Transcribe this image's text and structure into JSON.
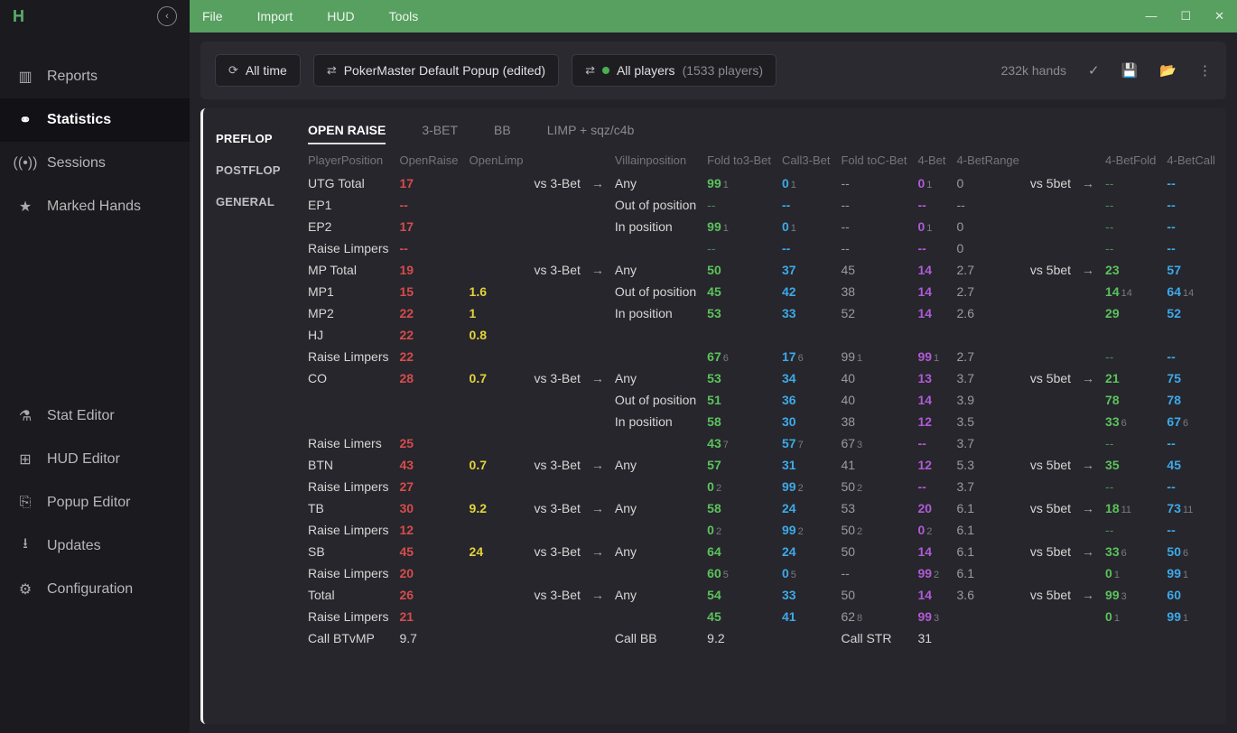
{
  "menubar": {
    "items": [
      "File",
      "Import",
      "HUD",
      "Tools"
    ]
  },
  "sidebar": {
    "top": [
      {
        "label": "Reports"
      },
      {
        "label": "Statistics"
      },
      {
        "label": "Sessions"
      },
      {
        "label": "Marked Hands"
      }
    ],
    "bottom": [
      {
        "label": "Stat Editor"
      },
      {
        "label": "HUD Editor"
      },
      {
        "label": "Popup Editor"
      },
      {
        "label": "Updates"
      },
      {
        "label": "Configuration"
      }
    ]
  },
  "toolbar": {
    "time_label": "All time",
    "popup_label": "PokerMaster Default Popup (edited)",
    "players_label": "All players",
    "players_count": "(1533 players)",
    "hands": "232k hands"
  },
  "subnav": {
    "items": [
      "PREFLOP",
      "POSTFLOP",
      "GENERAL"
    ],
    "active": 0
  },
  "stat_tabs": {
    "items": [
      "OPEN RAISE",
      "3-BET",
      "BB",
      "LIMP + sqz/c4b"
    ],
    "active": 0
  },
  "headers": {
    "left": [
      "PlayerPosition",
      "OpenRaise",
      "OpenLimp"
    ],
    "right": [
      "Villainposition",
      "Fold to3-Bet",
      "Call3-Bet",
      "Fold toC-Bet",
      "4-Bet",
      "4-BetRange",
      "4-BetFold",
      "4-BetCall"
    ]
  },
  "labels": {
    "vs3bet": "vs 3-Bet",
    "vs5bet": "vs 5bet",
    "arrow": "→"
  },
  "groups": [
    {
      "rows": [
        {
          "pp": "UTG Total",
          "or": {
            "v": "17",
            "c": "red"
          },
          "ol": null,
          "vs3": true,
          "vil": "Any",
          "f3": {
            "v": "99",
            "s": "1",
            "c": "green"
          },
          "c3": {
            "v": "0",
            "s": "1",
            "c": "blue"
          },
          "fc": {
            "v": "--",
            "c": "grey"
          },
          "b4": {
            "v": "0",
            "s": "1",
            "c": "purple"
          },
          "rng": {
            "v": "0",
            "c": "grey"
          },
          "vs5": true,
          "bf": {
            "v": "--",
            "c": "dash"
          },
          "bc": {
            "v": "--",
            "c": "blue"
          }
        },
        {
          "pp": "EP1",
          "or": {
            "v": "--",
            "c": "red"
          },
          "vil": "Out of position",
          "f3": {
            "v": "--",
            "c": "dash"
          },
          "c3": {
            "v": "--",
            "c": "blue"
          },
          "fc": {
            "v": "--",
            "c": "grey"
          },
          "b4": {
            "v": "--",
            "c": "purple"
          },
          "rng": {
            "v": "--",
            "c": "grey"
          },
          "bf": {
            "v": "--",
            "c": "dash"
          },
          "bc": {
            "v": "--",
            "c": "blue"
          }
        },
        {
          "pp": "EP2",
          "or": {
            "v": "17",
            "c": "red"
          },
          "vil": "In position",
          "f3": {
            "v": "99",
            "s": "1",
            "c": "green"
          },
          "c3": {
            "v": "0",
            "s": "1",
            "c": "blue"
          },
          "fc": {
            "v": "--",
            "c": "grey"
          },
          "b4": {
            "v": "0",
            "s": "1",
            "c": "purple"
          },
          "rng": {
            "v": "0",
            "c": "grey"
          },
          "bf": {
            "v": "--",
            "c": "dash"
          },
          "bc": {
            "v": "--",
            "c": "blue"
          }
        },
        {
          "pp": "Raise Limpers",
          "or": {
            "v": "--",
            "c": "red"
          },
          "f3": {
            "v": "--",
            "c": "dash"
          },
          "c3": {
            "v": "--",
            "c": "blue"
          },
          "fc": {
            "v": "--",
            "c": "grey"
          },
          "b4": {
            "v": "--",
            "c": "purple"
          },
          "rng": {
            "v": "0",
            "c": "grey"
          },
          "bf": {
            "v": "--",
            "c": "dash"
          },
          "bc": {
            "v": "--",
            "c": "blue"
          }
        }
      ]
    },
    {
      "rows": [
        {
          "pp": "MP Total",
          "or": {
            "v": "19",
            "c": "red"
          },
          "vs3": true,
          "vil": "Any",
          "f3": {
            "v": "50",
            "c": "green"
          },
          "c3": {
            "v": "37",
            "c": "blue"
          },
          "fc": {
            "v": "45",
            "c": "grey"
          },
          "b4": {
            "v": "14",
            "c": "purple"
          },
          "rng": {
            "v": "2.7",
            "c": "grey"
          },
          "vs5": true,
          "bf": {
            "v": "23",
            "c": "green"
          },
          "bc": {
            "v": "57",
            "c": "blue"
          }
        },
        {
          "pp": "MP1",
          "or": {
            "v": "15",
            "c": "red"
          },
          "ol": {
            "v": "1.6",
            "c": "yellow"
          },
          "vil": "Out of position",
          "f3": {
            "v": "45",
            "c": "green"
          },
          "c3": {
            "v": "42",
            "c": "blue"
          },
          "fc": {
            "v": "38",
            "c": "grey"
          },
          "b4": {
            "v": "14",
            "c": "purple"
          },
          "rng": {
            "v": "2.7",
            "c": "grey"
          },
          "bf": {
            "v": "14",
            "s": "14",
            "c": "green"
          },
          "bc": {
            "v": "64",
            "s": "14",
            "c": "blue"
          }
        },
        {
          "pp": "MP2",
          "or": {
            "v": "22",
            "c": "red"
          },
          "ol": {
            "v": "1",
            "c": "yellow"
          },
          "vil": "In position",
          "f3": {
            "v": "53",
            "c": "green"
          },
          "c3": {
            "v": "33",
            "c": "blue"
          },
          "fc": {
            "v": "52",
            "c": "grey"
          },
          "b4": {
            "v": "14",
            "c": "purple"
          },
          "rng": {
            "v": "2.6",
            "c": "grey"
          },
          "bf": {
            "v": "29",
            "c": "green"
          },
          "bc": {
            "v": "52",
            "c": "blue"
          }
        },
        {
          "pp": "HJ",
          "or": {
            "v": "22",
            "c": "red"
          },
          "ol": {
            "v": "0.8",
            "c": "yellow"
          }
        },
        {
          "pp": "Raise Limpers",
          "or": {
            "v": "22",
            "c": "red"
          },
          "f3": {
            "v": "67",
            "s": "6",
            "c": "green"
          },
          "c3": {
            "v": "17",
            "s": "6",
            "c": "blue"
          },
          "fc": {
            "v": "99",
            "s": "1",
            "c": "grey"
          },
          "b4": {
            "v": "99",
            "s": "1",
            "c": "purple"
          },
          "rng": {
            "v": "2.7",
            "c": "grey"
          },
          "bf": {
            "v": "--",
            "c": "dash"
          },
          "bc": {
            "v": "--",
            "c": "blue"
          }
        }
      ]
    },
    {
      "rows": [
        {
          "pp": "CO",
          "or": {
            "v": "28",
            "c": "red"
          },
          "ol": {
            "v": "0.7",
            "c": "yellow"
          },
          "vs3": true,
          "vil": "Any",
          "f3": {
            "v": "53",
            "c": "green"
          },
          "c3": {
            "v": "34",
            "c": "blue"
          },
          "fc": {
            "v": "40",
            "c": "grey"
          },
          "b4": {
            "v": "13",
            "c": "purple"
          },
          "rng": {
            "v": "3.7",
            "c": "grey"
          },
          "vs5": true,
          "bf": {
            "v": "21",
            "c": "green"
          },
          "bc": {
            "v": "75",
            "c": "blue"
          }
        },
        {
          "vil": "Out of position",
          "f3": {
            "v": "51",
            "c": "green"
          },
          "c3": {
            "v": "36",
            "c": "blue"
          },
          "fc": {
            "v": "40",
            "c": "grey"
          },
          "b4": {
            "v": "14",
            "c": "purple"
          },
          "rng": {
            "v": "3.9",
            "c": "grey"
          },
          "bf": {
            "v": "78",
            "c": "green"
          },
          "bc": {
            "v": "78",
            "c": "blue"
          }
        },
        {
          "vil": "In position",
          "f3": {
            "v": "58",
            "c": "green"
          },
          "c3": {
            "v": "30",
            "c": "blue"
          },
          "fc": {
            "v": "38",
            "c": "grey"
          },
          "b4": {
            "v": "12",
            "c": "purple"
          },
          "rng": {
            "v": "3.5",
            "c": "grey"
          },
          "bf": {
            "v": "33",
            "s": "6",
            "c": "green"
          },
          "bc": {
            "v": "67",
            "s": "6",
            "c": "blue"
          }
        },
        {
          "pp": "Raise Limers",
          "or": {
            "v": "25",
            "c": "red"
          },
          "f3": {
            "v": "43",
            "s": "7",
            "c": "green"
          },
          "c3": {
            "v": "57",
            "s": "7",
            "c": "blue"
          },
          "fc": {
            "v": "67",
            "s": "3",
            "c": "grey"
          },
          "b4": {
            "v": "--",
            "c": "purple"
          },
          "rng": {
            "v": "3.7",
            "c": "grey"
          },
          "bf": {
            "v": "--",
            "c": "dash"
          },
          "bc": {
            "v": "--",
            "c": "blue"
          }
        }
      ]
    },
    {
      "rows": [
        {
          "pp": "BTN",
          "or": {
            "v": "43",
            "c": "red"
          },
          "ol": {
            "v": "0.7",
            "c": "yellow"
          },
          "vs3": true,
          "vil": "Any",
          "f3": {
            "v": "57",
            "c": "green"
          },
          "c3": {
            "v": "31",
            "c": "blue"
          },
          "fc": {
            "v": "41",
            "c": "grey"
          },
          "b4": {
            "v": "12",
            "c": "purple"
          },
          "rng": {
            "v": "5.3",
            "c": "grey"
          },
          "vs5": true,
          "bf": {
            "v": "35",
            "c": "green"
          },
          "bc": {
            "v": "45",
            "c": "blue"
          }
        },
        {
          "pp": "Raise Limpers",
          "or": {
            "v": "27",
            "c": "red"
          },
          "f3": {
            "v": "0",
            "s": "2",
            "c": "green"
          },
          "c3": {
            "v": "99",
            "s": "2",
            "c": "blue"
          },
          "fc": {
            "v": "50",
            "s": "2",
            "c": "grey"
          },
          "b4": {
            "v": "--",
            "c": "purple"
          },
          "rng": {
            "v": "3.7",
            "c": "grey"
          },
          "bf": {
            "v": "--",
            "c": "dash"
          },
          "bc": {
            "v": "--",
            "c": "blue"
          }
        }
      ]
    },
    {
      "rows": [
        {
          "pp": "TB",
          "or": {
            "v": "30",
            "c": "red"
          },
          "ol": {
            "v": "9.2",
            "c": "yellow"
          },
          "vs3": true,
          "vil": "Any",
          "f3": {
            "v": "58",
            "c": "green"
          },
          "c3": {
            "v": "24",
            "c": "blue"
          },
          "fc": {
            "v": "53",
            "c": "grey"
          },
          "b4": {
            "v": "20",
            "c": "purple"
          },
          "rng": {
            "v": "6.1",
            "c": "grey"
          },
          "vs5": true,
          "bf": {
            "v": "18",
            "s": "11",
            "c": "green"
          },
          "bc": {
            "v": "73",
            "s": "11",
            "c": "blue"
          }
        },
        {
          "pp": "Raise Limpers",
          "or": {
            "v": "12",
            "c": "red"
          },
          "f3": {
            "v": "0",
            "s": "2",
            "c": "green"
          },
          "c3": {
            "v": "99",
            "s": "2",
            "c": "blue"
          },
          "fc": {
            "v": "50",
            "s": "2",
            "c": "grey"
          },
          "b4": {
            "v": "0",
            "s": "2",
            "c": "purple"
          },
          "rng": {
            "v": "6.1",
            "c": "grey"
          },
          "bf": {
            "v": "--",
            "c": "dash"
          },
          "bc": {
            "v": "--",
            "c": "blue"
          }
        }
      ]
    },
    {
      "rows": [
        {
          "pp": "SB",
          "or": {
            "v": "45",
            "c": "red"
          },
          "ol": {
            "v": "24",
            "c": "yellow"
          },
          "vs3": true,
          "vil": "Any",
          "f3": {
            "v": "64",
            "c": "green"
          },
          "c3": {
            "v": "24",
            "c": "blue"
          },
          "fc": {
            "v": "50",
            "c": "grey"
          },
          "b4": {
            "v": "14",
            "c": "purple"
          },
          "rng": {
            "v": "6.1",
            "c": "grey"
          },
          "vs5": true,
          "bf": {
            "v": "33",
            "s": "6",
            "c": "green"
          },
          "bc": {
            "v": "50",
            "s": "6",
            "c": "blue"
          }
        },
        {
          "pp": "Raise Limpers",
          "or": {
            "v": "20",
            "c": "red"
          },
          "f3": {
            "v": "60",
            "s": "5",
            "c": "green"
          },
          "c3": {
            "v": "0",
            "s": "5",
            "c": "blue"
          },
          "fc": {
            "v": "--",
            "c": "grey"
          },
          "b4": {
            "v": "99",
            "s": "2",
            "c": "purple"
          },
          "rng": {
            "v": "6.1",
            "c": "grey"
          },
          "bf": {
            "v": "0",
            "s": "1",
            "c": "green"
          },
          "bc": {
            "v": "99",
            "s": "1",
            "c": "blue"
          }
        }
      ]
    },
    {
      "rows": [
        {
          "pp": "Total",
          "or": {
            "v": "26",
            "c": "red"
          },
          "vs3": true,
          "vil": "Any",
          "f3": {
            "v": "54",
            "c": "green"
          },
          "c3": {
            "v": "33",
            "c": "blue"
          },
          "fc": {
            "v": "50",
            "c": "grey"
          },
          "b4": {
            "v": "14",
            "c": "purple"
          },
          "rng": {
            "v": "3.6",
            "c": "grey"
          },
          "vs5": true,
          "bf": {
            "v": "99",
            "s": "3",
            "c": "green"
          },
          "bc": {
            "v": "60",
            "c": "blue"
          }
        },
        {
          "pp": "Raise Limpers",
          "or": {
            "v": "21",
            "c": "red"
          },
          "f3": {
            "v": "45",
            "c": "green"
          },
          "c3": {
            "v": "41",
            "c": "blue"
          },
          "fc": {
            "v": "62",
            "s": "8",
            "c": "grey"
          },
          "b4": {
            "v": "99",
            "s": "3",
            "c": "purple"
          },
          "bf": {
            "v": "0",
            "s": "1",
            "c": "green"
          },
          "bc": {
            "v": "99",
            "s": "1",
            "c": "blue"
          }
        }
      ]
    }
  ],
  "footer": {
    "cells": [
      {
        "label": "Call BTvMP",
        "value": "9.7"
      },
      {
        "label": "Call BB",
        "value": "9.2"
      },
      {
        "label": "Call STR",
        "value": "31"
      }
    ]
  }
}
